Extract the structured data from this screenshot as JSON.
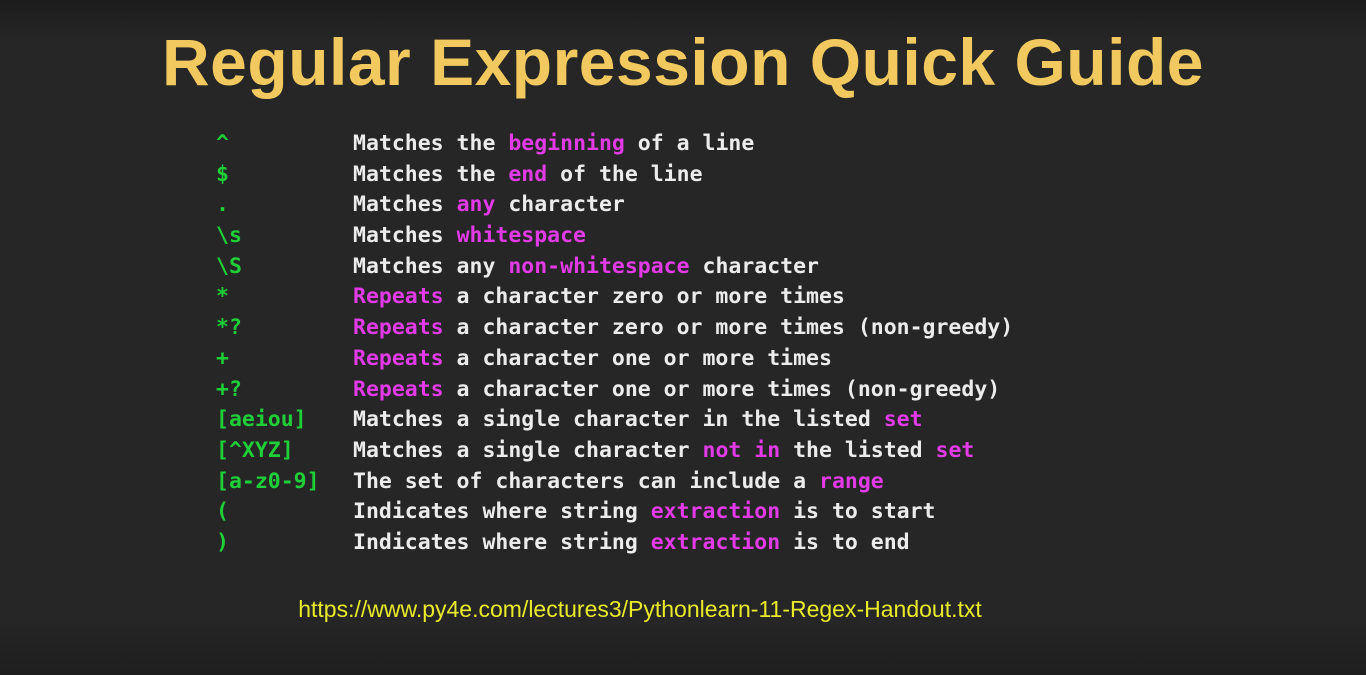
{
  "slide": {
    "title": "Regular Expression Quick Guide",
    "link": "https://www.py4e.com/lectures3/Pythonlearn-11-Regex-Handout.txt"
  },
  "colors": {
    "title": "#f2c95e",
    "pattern": "#1fcf38",
    "text": "#ececec",
    "highlight": "#e13ae6",
    "link": "#e8ea2a",
    "background": "#262626"
  },
  "rows": [
    {
      "pattern": "^",
      "parts": [
        {
          "t": "Matches the "
        },
        {
          "t": "beginning",
          "hl": true
        },
        {
          "t": " of a line"
        }
      ]
    },
    {
      "pattern": "$",
      "parts": [
        {
          "t": "Matches the "
        },
        {
          "t": "end",
          "hl": true
        },
        {
          "t": " of the line"
        }
      ]
    },
    {
      "pattern": ".",
      "parts": [
        {
          "t": "Matches "
        },
        {
          "t": "any",
          "hl": true
        },
        {
          "t": " character"
        }
      ]
    },
    {
      "pattern": "\\s",
      "parts": [
        {
          "t": "Matches "
        },
        {
          "t": "whitespace",
          "hl": true
        }
      ]
    },
    {
      "pattern": "\\S",
      "parts": [
        {
          "t": "Matches any "
        },
        {
          "t": "non-whitespace",
          "hl": true
        },
        {
          "t": " character"
        }
      ]
    },
    {
      "pattern": "*",
      "parts": [
        {
          "t": "Repeats",
          "hl": true
        },
        {
          "t": " a character zero or more times"
        }
      ]
    },
    {
      "pattern": "*?",
      "parts": [
        {
          "t": "Repeats",
          "hl": true
        },
        {
          "t": " a character zero or more times (non-greedy)"
        }
      ]
    },
    {
      "pattern": "+",
      "parts": [
        {
          "t": "Repeats",
          "hl": true
        },
        {
          "t": " a character one or more times"
        }
      ]
    },
    {
      "pattern": "+?",
      "parts": [
        {
          "t": "Repeats",
          "hl": true
        },
        {
          "t": " a character one or more times (non-greedy)"
        }
      ]
    },
    {
      "pattern": "[aeiou]",
      "parts": [
        {
          "t": "Matches a single character in the listed "
        },
        {
          "t": "set",
          "hl": true
        }
      ]
    },
    {
      "pattern": "[^XYZ]",
      "parts": [
        {
          "t": "Matches a single character "
        },
        {
          "t": "not in",
          "hl": true
        },
        {
          "t": " the listed "
        },
        {
          "t": "set",
          "hl": true
        }
      ]
    },
    {
      "pattern": "[a-z0-9]",
      "parts": [
        {
          "t": "The set of characters can include a "
        },
        {
          "t": "range",
          "hl": true
        }
      ]
    },
    {
      "pattern": "(",
      "parts": [
        {
          "t": "Indicates where string "
        },
        {
          "t": "extraction",
          "hl": true
        },
        {
          "t": " is to start"
        }
      ]
    },
    {
      "pattern": ")",
      "parts": [
        {
          "t": "Indicates where string "
        },
        {
          "t": "extraction",
          "hl": true
        },
        {
          "t": " is to end"
        }
      ]
    }
  ]
}
